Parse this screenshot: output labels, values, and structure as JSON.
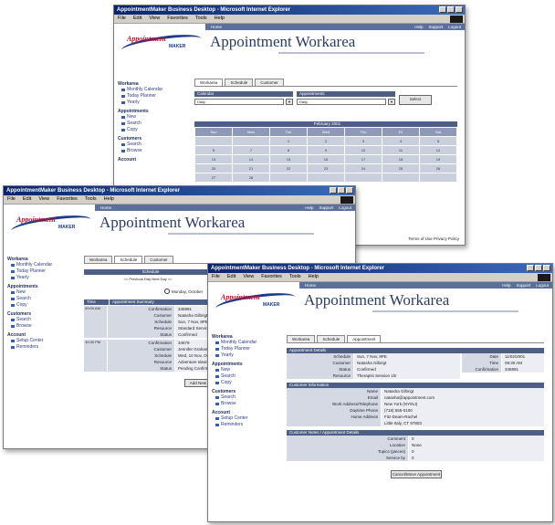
{
  "browser": {
    "window_title": "AppointmentMaker Business Desktop - Microsoft Internet Explorer",
    "menu": [
      "File",
      "Edit",
      "View",
      "Favorites",
      "Tools",
      "Help"
    ]
  },
  "brand": {
    "logo_text": "Appointment",
    "logo_sub": "MAKER",
    "app_title": "Appointment Workarea"
  },
  "nav": {
    "home": "Home",
    "links": [
      "Help",
      "Support",
      "Logout"
    ]
  },
  "sidebar": {
    "sections": [
      {
        "title": "Workarea",
        "items": [
          "Monthly Calendar",
          "Today Planner",
          "Yearly"
        ]
      },
      {
        "title": "Appointments",
        "items": [
          "New",
          "Search",
          "Copy"
        ]
      },
      {
        "title": "Customers",
        "items": [
          "Search",
          "Browse"
        ]
      },
      {
        "title": "Account",
        "items": [
          "Setup Center",
          "Reminders"
        ]
      }
    ]
  },
  "win1": {
    "tabs": [
      "Workarea",
      "Schedule",
      "Customer"
    ],
    "left_header": "Calendar",
    "right_header": "Appointments",
    "left_value": "Daily",
    "right_value": "Daily",
    "button": "Select",
    "cal_title": "February 2001",
    "weekdays": [
      "Sun",
      "Mon",
      "Tue",
      "Wed",
      "Thu",
      "Fri",
      "Sat"
    ],
    "weeks": [
      [
        "",
        "",
        "1",
        "2",
        "3",
        "4",
        "5"
      ],
      [
        "6",
        "7",
        "8",
        "9",
        "10",
        "11",
        "12"
      ],
      [
        "13",
        "14",
        "15",
        "16",
        "17",
        "18",
        "19"
      ],
      [
        "20",
        "21",
        "22",
        "23",
        "24",
        "25",
        "26"
      ],
      [
        "27",
        "28",
        "",
        "",
        "",
        "",
        ""
      ]
    ],
    "footer_link": "Terms of Use Privacy Policy"
  },
  "win2": {
    "tabs": [
      "Workarea",
      "Schedule",
      "Customer"
    ],
    "day_header": "Schedule",
    "nav": "<< Previous Day  Next Day >>",
    "radio_label": "Monday, October",
    "list_headers": [
      "Time",
      "Appointment Summary"
    ],
    "appointments": [
      {
        "time": "09:00 AM",
        "fields": [
          {
            "k": "Confirmation",
            "v": "345991"
          },
          {
            "k": "Customer",
            "v": "Natasha Gilbrigt"
          },
          {
            "k": "Schedule",
            "v": "Sun, 7 Nov, 8PE"
          },
          {
            "k": "Resource",
            "v": "Standard Services"
          },
          {
            "k": "Status",
            "v": "Confirmed"
          }
        ]
      },
      {
        "time": "10:30 PM",
        "fields": [
          {
            "k": "Confirmation",
            "v": "34679"
          },
          {
            "k": "Customer",
            "v": "Jennifer Graham"
          },
          {
            "k": "Schedule",
            "v": "Wed, 10 Nov, Ocupcion"
          },
          {
            "k": "Resource",
            "v": "Adventure Ideal Hat"
          },
          {
            "k": "Status",
            "v": "Pending Confirmation"
          }
        ]
      }
    ],
    "button": "Add New Appointment"
  },
  "win3": {
    "tabs": [
      "Workarea",
      "Schedule",
      "Appointment"
    ],
    "sec1": "Appointment Details",
    "details": [
      {
        "k": "Schedule",
        "v": "Sun, 7 Nov, 8PE"
      },
      {
        "k": "Customer",
        "v": "Natasha Gilbrigt"
      },
      {
        "k": "Status",
        "v": "Confirmed"
      },
      {
        "k": "Resource",
        "v": "Therapist Session 1hr"
      }
    ],
    "details_right": [
      {
        "k": "Date",
        "v": "11/02/2001"
      },
      {
        "k": "Time",
        "v": "09:30 AM"
      },
      {
        "k": "Confirmation",
        "v": "345991"
      }
    ],
    "sec2": "Customer Information",
    "customer": [
      {
        "k": "Name",
        "v": "Natasha Gilbrigt"
      },
      {
        "k": "Email",
        "v": "natasha@appointment.com"
      },
      {
        "k": "Work Address/Telephone",
        "v": "New York (NY/NJ)"
      },
      {
        "k": "Daytime Phone",
        "v": "(718) 555-0100"
      },
      {
        "k": "Home Address",
        "v": "Fitz-Deam-Rachel"
      },
      {
        "k": "",
        "v": "Little Italy, CT 97803"
      }
    ],
    "sec3": "Customer Notes / Appointment Details",
    "notes": [
      {
        "k": "Comment",
        "v": "0"
      },
      {
        "k": "Location",
        "v": "None"
      },
      {
        "k": "Topics (pieces)",
        "v": "0"
      },
      {
        "k": "Service by",
        "v": "0"
      }
    ],
    "button": "Cancel/Move Appointment"
  },
  "colors": {
    "title_bar": "#0a246a",
    "nav_strip": "#5a6f9c",
    "table_header": "#4d5f86",
    "logo_red": "#c8102e",
    "logo_blue": "#1c3a8a"
  }
}
